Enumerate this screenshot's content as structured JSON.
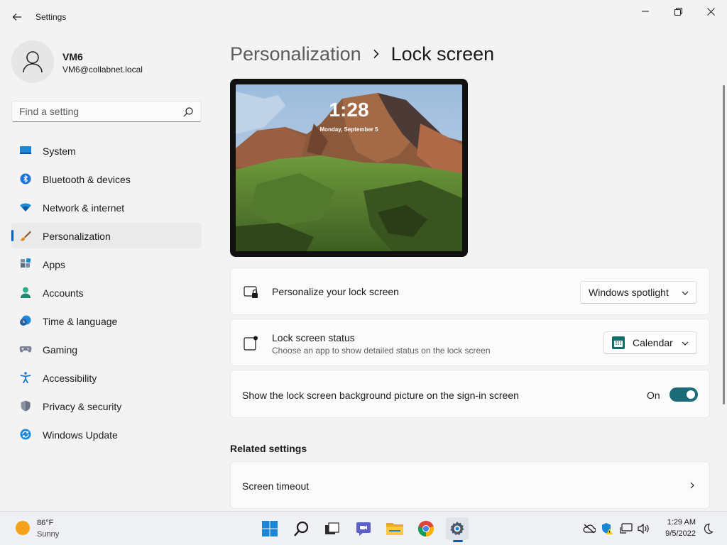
{
  "window": {
    "app_title": "Settings"
  },
  "user": {
    "name": "VM6",
    "email": "VM6@collabnet.local"
  },
  "search": {
    "placeholder": "Find a setting"
  },
  "sidebar": {
    "items": [
      {
        "label": "System",
        "icon": "system-icon",
        "active": false
      },
      {
        "label": "Bluetooth & devices",
        "icon": "bluetooth-icon",
        "active": false
      },
      {
        "label": "Network & internet",
        "icon": "wifi-icon",
        "active": false
      },
      {
        "label": "Personalization",
        "icon": "brush-icon",
        "active": true
      },
      {
        "label": "Apps",
        "icon": "apps-icon",
        "active": false
      },
      {
        "label": "Accounts",
        "icon": "accounts-icon",
        "active": false
      },
      {
        "label": "Time & language",
        "icon": "clock-globe-icon",
        "active": false
      },
      {
        "label": "Gaming",
        "icon": "gamepad-icon",
        "active": false
      },
      {
        "label": "Accessibility",
        "icon": "accessibility-icon",
        "active": false
      },
      {
        "label": "Privacy & security",
        "icon": "shield-icon",
        "active": false
      },
      {
        "label": "Windows Update",
        "icon": "update-icon",
        "active": false
      }
    ]
  },
  "breadcrumb": {
    "parent": "Personalization",
    "current": "Lock screen"
  },
  "preview": {
    "time": "1:28",
    "date": "Monday, September 5"
  },
  "settings": {
    "personalize": {
      "title": "Personalize your lock screen",
      "value": "Windows spotlight"
    },
    "status": {
      "title": "Lock screen status",
      "subtitle": "Choose an app to show detailed status on the lock screen",
      "value": "Calendar"
    },
    "signin_background": {
      "title": "Show the lock screen background picture on the sign-in screen",
      "state_label": "On",
      "on": true
    }
  },
  "related": {
    "heading": "Related settings",
    "screen_timeout": "Screen timeout"
  },
  "taskbar": {
    "weather": {
      "temperature": "86°F",
      "condition": "Sunny"
    },
    "apps": [
      "start-icon",
      "search-icon",
      "task-view-icon",
      "chat-icon",
      "file-explorer-icon",
      "chrome-icon",
      "settings-icon"
    ],
    "clock": {
      "time": "1:29 AM",
      "date": "9/5/2022"
    }
  },
  "colors": {
    "accent": "#005fb8",
    "toggle_on": "#1a6a78"
  }
}
